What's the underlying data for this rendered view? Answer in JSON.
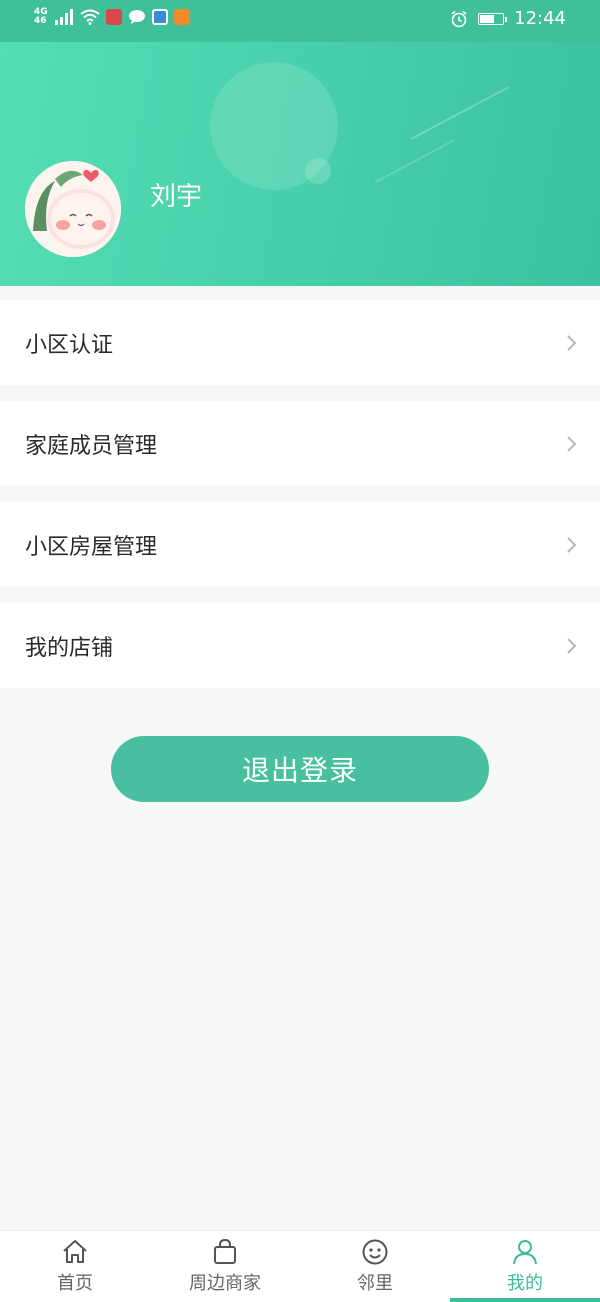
{
  "status_bar": {
    "network": "4G",
    "network_sub": "46",
    "time": "12:44",
    "battery_level": 0.65,
    "apps": [
      {
        "name": "reader-app-icon",
        "color": "#d84a4a"
      },
      {
        "name": "chat-app-icon",
        "color": "#ffffff"
      },
      {
        "name": "browser-app-icon",
        "color": "#3b8bd8"
      },
      {
        "name": "video-app-icon",
        "color": "#f08a2b"
      }
    ]
  },
  "profile": {
    "user_name": "刘宇"
  },
  "menu": {
    "items": [
      {
        "label": "小区认证"
      },
      {
        "label": "家庭成员管理"
      },
      {
        "label": "小区房屋管理"
      },
      {
        "label": "我的店铺"
      }
    ]
  },
  "logout": {
    "label": "退出登录"
  },
  "tabs": [
    {
      "label": "首页",
      "icon": "home-icon",
      "active": false
    },
    {
      "label": "周边商家",
      "icon": "shopping-bag-icon",
      "active": false
    },
    {
      "label": "邻里",
      "icon": "smiley-icon",
      "active": false
    },
    {
      "label": "我的",
      "icon": "person-icon",
      "active": true
    }
  ],
  "colors": {
    "accent": "#3cbc98",
    "header_start": "#55ddb5",
    "header_end": "#3cc29e",
    "tab_inactive": "#666666"
  }
}
